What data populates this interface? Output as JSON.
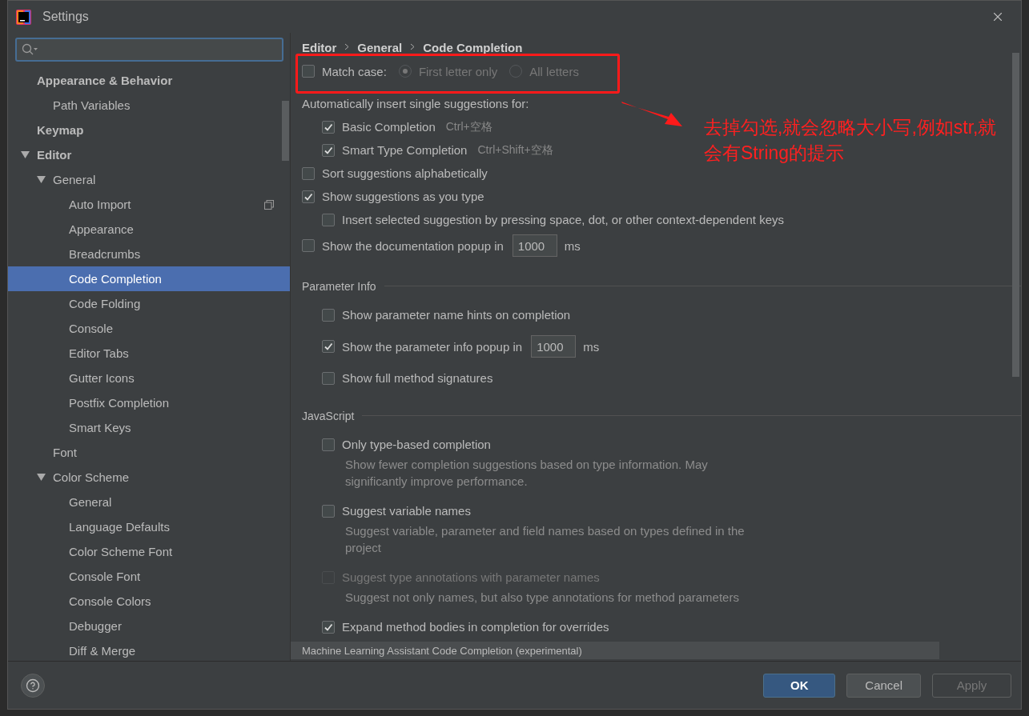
{
  "window": {
    "title": "Settings"
  },
  "sidebar": {
    "items": [
      {
        "label": "Appearance & Behavior",
        "selected": false,
        "children": [
          {
            "label": "Path Variables",
            "selected": false
          }
        ]
      },
      {
        "label": "Keymap",
        "selected": false
      },
      {
        "label": "Editor",
        "selected": false,
        "expanded": true,
        "children": [
          {
            "label": "General",
            "selected": false,
            "expanded": true,
            "children": [
              {
                "label": "Auto Import",
                "selected": false,
                "project_scoped": true
              },
              {
                "label": "Appearance",
                "selected": false
              },
              {
                "label": "Breadcrumbs",
                "selected": false
              },
              {
                "label": "Code Completion",
                "selected": true
              },
              {
                "label": "Code Folding",
                "selected": false
              },
              {
                "label": "Console",
                "selected": false
              },
              {
                "label": "Editor Tabs",
                "selected": false
              },
              {
                "label": "Gutter Icons",
                "selected": false
              },
              {
                "label": "Postfix Completion",
                "selected": false
              },
              {
                "label": "Smart Keys",
                "selected": false
              }
            ]
          },
          {
            "label": "Font",
            "selected": false
          },
          {
            "label": "Color Scheme",
            "selected": false,
            "expanded": true,
            "children": [
              {
                "label": "General",
                "selected": false
              },
              {
                "label": "Language Defaults",
                "selected": false
              },
              {
                "label": "Color Scheme Font",
                "selected": false
              },
              {
                "label": "Console Font",
                "selected": false
              },
              {
                "label": "Console Colors",
                "selected": false
              },
              {
                "label": "Debugger",
                "selected": false
              },
              {
                "label": "Diff & Merge",
                "selected": false
              }
            ]
          }
        ]
      }
    ]
  },
  "content": {
    "breadcrumb": [
      "Editor",
      "General",
      "Code Completion"
    ],
    "match_case": {
      "label": "Match case:",
      "checked": false,
      "options": [
        {
          "label": "First letter only",
          "selected": true,
          "disabled": true
        },
        {
          "label": "All letters",
          "selected": false,
          "disabled": true
        }
      ]
    },
    "options": [
      {
        "kind": "heading",
        "label": "Automatically insert single suggestions for:",
        "children": [
          {
            "kind": "checkbox",
            "label": "Basic Completion",
            "checked": true,
            "shortcut": "Ctrl+空格"
          },
          {
            "kind": "checkbox",
            "label": "Smart Type Completion",
            "checked": true,
            "shortcut": "Ctrl+Shift+空格"
          }
        ]
      },
      {
        "kind": "checkbox",
        "label": "Sort suggestions alphabetically",
        "checked": false
      },
      {
        "kind": "checkbox",
        "label": "Show suggestions as you type",
        "checked": true,
        "children": [
          {
            "kind": "checkbox",
            "label": "Insert selected suggestion by pressing space, dot, or other context-dependent keys",
            "checked": false
          }
        ]
      },
      {
        "kind": "checkbox",
        "label": "Show the documentation popup in",
        "checked": false,
        "value": "1000",
        "unit": "ms"
      }
    ],
    "sections": [
      {
        "title": "Parameter Info",
        "options": [
          {
            "kind": "checkbox",
            "label": "Show parameter name hints on completion",
            "checked": false
          },
          {
            "kind": "checkbox",
            "label": "Show the parameter info popup in",
            "checked": true,
            "value": "1000",
            "unit": "ms"
          },
          {
            "kind": "checkbox",
            "label": "Show full method signatures",
            "checked": false
          }
        ]
      },
      {
        "title": "JavaScript",
        "options": [
          {
            "kind": "checkbox",
            "label": "Only type-based completion",
            "checked": false,
            "disabled": false,
            "description": "Show fewer completion suggestions based on type information. May significantly improve performance."
          },
          {
            "kind": "checkbox",
            "label": "Suggest variable names",
            "checked": false,
            "disabled": false,
            "description": "Suggest variable, parameter and field names based on types defined in the project"
          },
          {
            "kind": "checkbox",
            "label": "Suggest type annotations with parameter names",
            "checked": false,
            "disabled": true,
            "description": "Suggest not only names, but also type annotations for method parameters"
          },
          {
            "kind": "checkbox",
            "label": "Expand method bodies in completion for overrides",
            "checked": true,
            "disabled": false
          }
        ]
      },
      {
        "title": "Machine Learning Assistant Code Completion (experimental)"
      }
    ]
  },
  "annotation": {
    "lines": [
      "去掉勾选,就会忽略大小写,例如str,就",
      "会有String的提示"
    ]
  },
  "buttons": [
    {
      "label": "OK",
      "kind": "primary"
    },
    {
      "label": "Cancel",
      "kind": "normal"
    },
    {
      "label": "Apply",
      "kind": "disabled"
    }
  ]
}
